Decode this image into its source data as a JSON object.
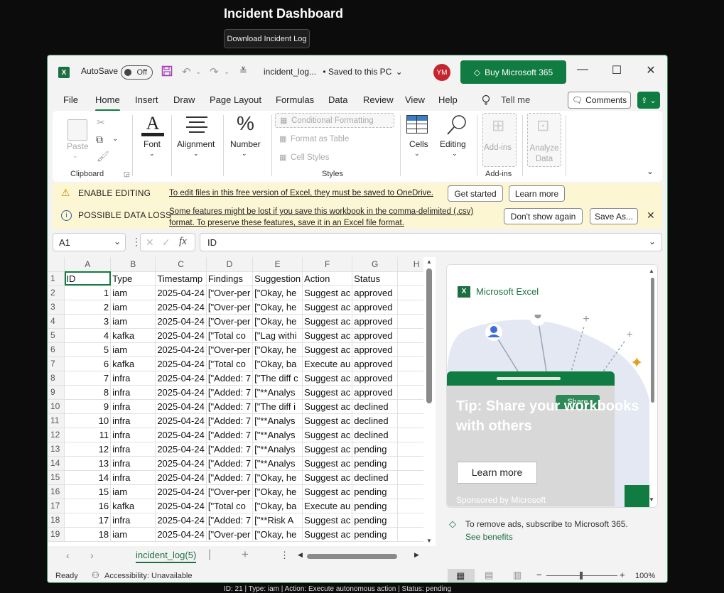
{
  "page": {
    "title": "Incident Dashboard",
    "download_label": "Download Incident Log",
    "footer_text": "ID: 21 | Type: iam | Action: Execute autonomous action | Status: pending"
  },
  "window": {
    "autosave_label": "AutoSave",
    "autosave_state": "Off",
    "filename": "incident_log...",
    "save_status": "• Saved to this PC",
    "user_initials": "YM",
    "buy_label": "Buy Microsoft 365"
  },
  "menu": {
    "items": [
      "File",
      "Home",
      "Insert",
      "Draw",
      "Page Layout",
      "Formulas",
      "Data",
      "Review",
      "View",
      "Help"
    ],
    "tell_me": "Tell me",
    "comments_label": "Comments"
  },
  "ribbon": {
    "paste": "Paste",
    "clipboard": "Clipboard",
    "font": "Font",
    "alignment": "Alignment",
    "number": "Number",
    "conditional_formatting": "Conditional Formatting",
    "format_as_table": "Format as Table",
    "cell_styles": "Cell Styles",
    "styles": "Styles",
    "cells": "Cells",
    "editing": "Editing",
    "add_ins": "Add-ins",
    "add_ins_group": "Add-ins",
    "analyze_data": "Analyze Data"
  },
  "notices": {
    "editing": {
      "label": "ENABLE EDITING",
      "message": "To edit files in this free version of Excel, they must be saved to OneDrive.",
      "btn1": "Get started",
      "btn2": "Learn more"
    },
    "dataloss": {
      "label": "POSSIBLE DATA LOSS",
      "message": "Some features might be lost if you save this workbook in the comma-delimited (.csv) format. To preserve these features, save it in an Excel file format.",
      "btn1": "Don't show again",
      "btn2": "Save As..."
    }
  },
  "formula_bar": {
    "cell_ref": "A1",
    "value": "ID"
  },
  "sheet": {
    "columns": [
      "A",
      "B",
      "C",
      "D",
      "E",
      "F",
      "G",
      "H"
    ],
    "header_row": [
      "ID",
      "Type",
      "Timestamp",
      "Findings",
      "Suggestion",
      "Action",
      "Status",
      ""
    ],
    "rows": [
      [
        "1",
        "iam",
        "2025-04-24",
        "[\"Over-per",
        "[\"Okay, he",
        "Suggest ac",
        "approved"
      ],
      [
        "2",
        "iam",
        "2025-04-24",
        "[\"Over-per",
        "[\"Okay, he",
        "Suggest ac",
        "approved"
      ],
      [
        "3",
        "iam",
        "2025-04-24",
        "[\"Over-per",
        "[\"Okay, he",
        "Suggest ac",
        "approved"
      ],
      [
        "4",
        "kafka",
        "2025-04-24",
        "[\"Total co",
        "[\"Lag withi",
        "Suggest ac",
        "approved"
      ],
      [
        "5",
        "iam",
        "2025-04-24",
        "[\"Over-per",
        "[\"Okay, he",
        "Suggest ac",
        "approved"
      ],
      [
        "6",
        "kafka",
        "2025-04-24",
        "[\"Total co",
        "[\"Okay, ba",
        "Execute au",
        "approved"
      ],
      [
        "7",
        "infra",
        "2025-04-24",
        "[\"Added: 7",
        "[\"The diff c",
        "Suggest ac",
        "approved"
      ],
      [
        "8",
        "infra",
        "2025-04-24",
        "[\"Added: 7",
        "[\"**Analys",
        "Suggest ac",
        "approved"
      ],
      [
        "9",
        "infra",
        "2025-04-24",
        "[\"Added: 7",
        "[\"The diff i",
        "Suggest ac",
        "declined"
      ],
      [
        "10",
        "infra",
        "2025-04-24",
        "[\"Added: 7",
        "[\"**Analys",
        "Suggest ac",
        "declined"
      ],
      [
        "11",
        "infra",
        "2025-04-24",
        "[\"Added: 7",
        "[\"**Analys",
        "Suggest ac",
        "declined"
      ],
      [
        "12",
        "infra",
        "2025-04-24",
        "[\"Added: 7",
        "[\"**Analys",
        "Suggest ac",
        "pending"
      ],
      [
        "13",
        "infra",
        "2025-04-24",
        "[\"Added: 7",
        "[\"**Analys",
        "Suggest ac",
        "pending"
      ],
      [
        "14",
        "infra",
        "2025-04-24",
        "[\"Added: 7",
        "[\"Okay, he",
        "Suggest ac",
        "declined"
      ],
      [
        "15",
        "iam",
        "2025-04-24",
        "[\"Over-per",
        "[\"Okay, he",
        "Suggest ac",
        "pending"
      ],
      [
        "16",
        "kafka",
        "2025-04-24",
        "[\"Total co",
        "[\"Okay, ba",
        "Execute au",
        "pending"
      ],
      [
        "17",
        "infra",
        "2025-04-24",
        "[\"Added: 7",
        "[\"**Risk A",
        "Suggest ac",
        "pending"
      ],
      [
        "18",
        "iam",
        "2025-04-24",
        "[\"Over-per",
        "[\"Okay, he",
        "Suggest ac",
        "pending"
      ]
    ]
  },
  "ad": {
    "brand": "Microsoft Excel",
    "tip": "Tip: Share your workbooks with others",
    "learn_more": "Learn more",
    "sponsored": "Sponsored by Microsoft",
    "share_chip": "Share",
    "remove_ads": "To remove ads, subscribe to Microsoft 365.",
    "see_benefits": "See benefits"
  },
  "sheet_tab": "incident_log(5)",
  "status": {
    "ready": "Ready",
    "accessibility": "Accessibility: Unavailable",
    "zoom": "100%"
  },
  "colors": {
    "brand_green": "#107c41",
    "notice_bg": "#fdf6d3",
    "avatar_red": "#c4262e"
  }
}
